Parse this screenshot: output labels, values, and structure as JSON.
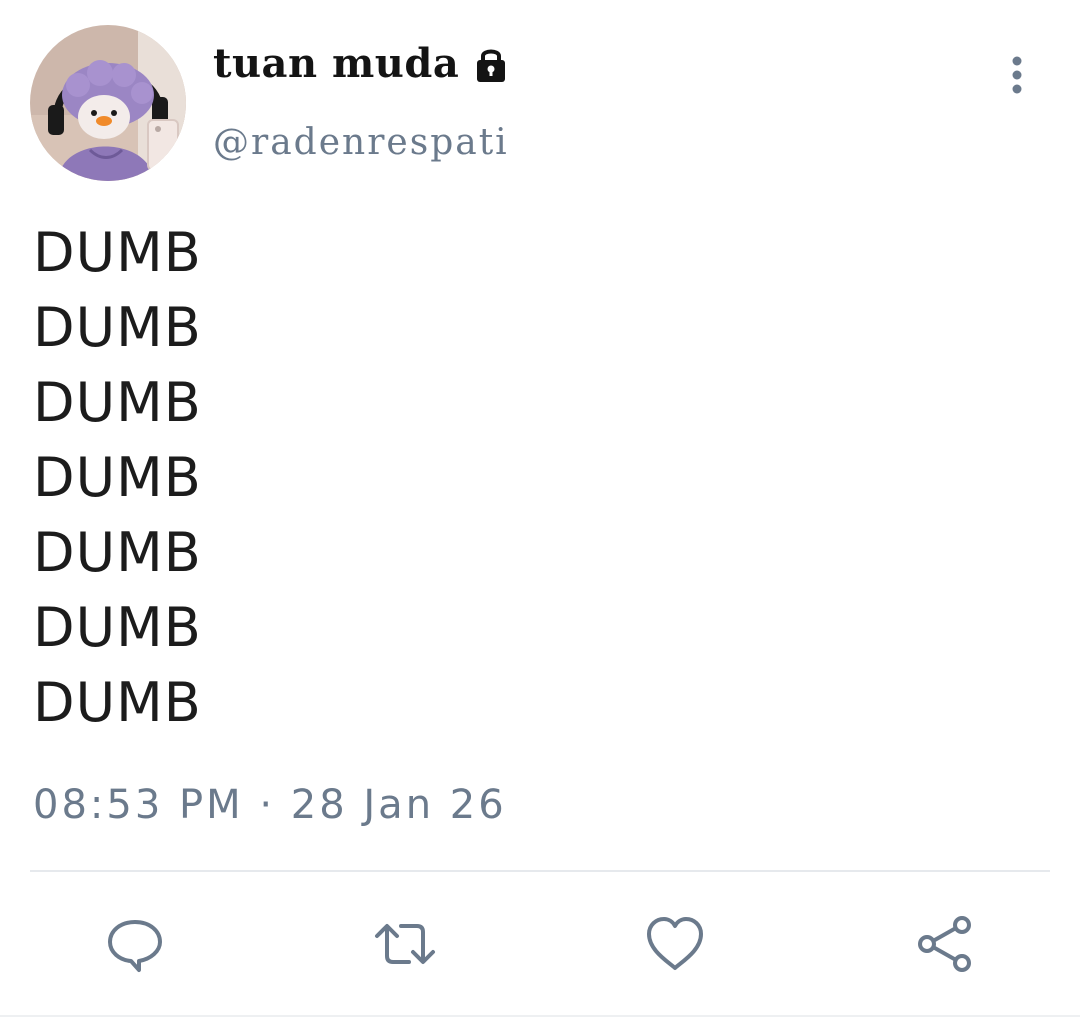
{
  "tweet": {
    "author": {
      "display_name": "tuan muda",
      "handle": "@radenrespati",
      "protected_icon": "lock-icon",
      "avatar": "avatar-photo"
    },
    "menu_icon": "more-vertical-icon",
    "body_lines": [
      "DUMB",
      "DUMB",
      "DUMB",
      "DUMB",
      "DUMB",
      "DUMB",
      "DUMB"
    ],
    "timestamp": "08:53 PM · 28 Jan 26",
    "actions": [
      {
        "name": "reply",
        "icon": "reply-icon"
      },
      {
        "name": "retweet",
        "icon": "retweet-icon"
      },
      {
        "name": "like",
        "icon": "heart-icon"
      },
      {
        "name": "share",
        "icon": "share-icon"
      }
    ]
  },
  "colors": {
    "text_primary": "#141414",
    "text_secondary": "#6b7a8c",
    "divider": "#e6e9ed",
    "background": "#ffffff"
  }
}
